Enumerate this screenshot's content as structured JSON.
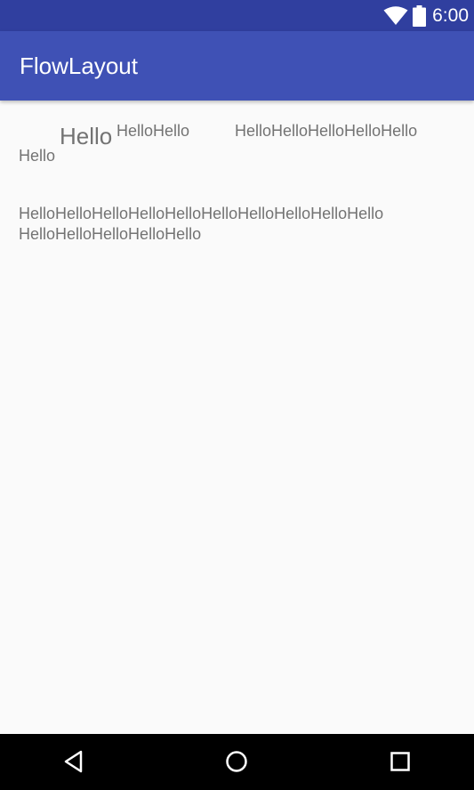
{
  "status_bar": {
    "time": "6:00",
    "icons": [
      "wifi-icon",
      "battery-icon"
    ],
    "color": "#303f9f"
  },
  "app_bar": {
    "title": "FlowLayout",
    "color": "#3f51b5"
  },
  "flow": {
    "row1": {
      "item1": "Hello",
      "item2": "HelloHello",
      "item3": "HelloHelloHelloHelloHello",
      "item4": "Hello"
    },
    "row2": {
      "line1": "HelloHelloHelloHelloHelloHelloHelloHelloHelloHello",
      "line2": "HelloHelloHelloHelloHello"
    },
    "text_color": "#737373"
  },
  "nav_bar": {
    "icons": [
      "back-icon",
      "home-icon",
      "recents-icon"
    ]
  }
}
